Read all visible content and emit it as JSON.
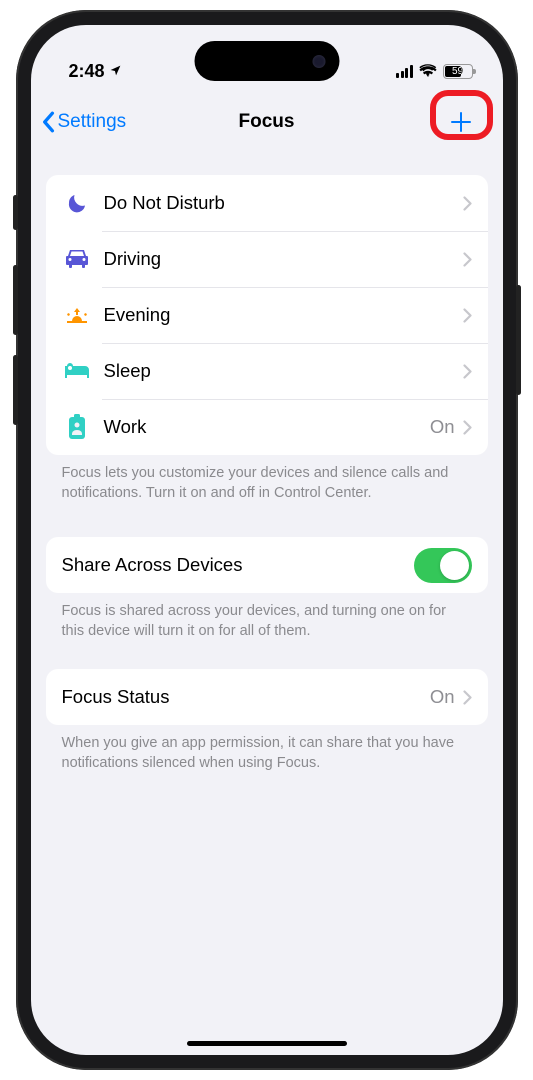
{
  "status": {
    "time": "2:48",
    "battery_pct": "59"
  },
  "nav": {
    "back_label": "Settings",
    "title": "Focus"
  },
  "focus_modes": [
    {
      "icon": "moon",
      "color": "#5856d6",
      "label": "Do Not Disturb",
      "detail": ""
    },
    {
      "icon": "car",
      "color": "#5856d6",
      "label": "Driving",
      "detail": ""
    },
    {
      "icon": "sunset",
      "color": "#ff9500",
      "label": "Evening",
      "detail": ""
    },
    {
      "icon": "bed",
      "color": "#30d0c4",
      "label": "Sleep",
      "detail": ""
    },
    {
      "icon": "badge",
      "color": "#30d0c4",
      "label": "Work",
      "detail": "On"
    }
  ],
  "focus_footer": "Focus lets you customize your devices and silence calls and notifications. Turn it on and off in Control Center.",
  "share": {
    "label": "Share Across Devices",
    "footer": "Focus is shared across your devices, and turning one on for this device will turn it on for all of them."
  },
  "focus_status": {
    "label": "Focus Status",
    "detail": "On",
    "footer": "When you give an app permission, it can share that you have notifications silenced when using Focus."
  }
}
